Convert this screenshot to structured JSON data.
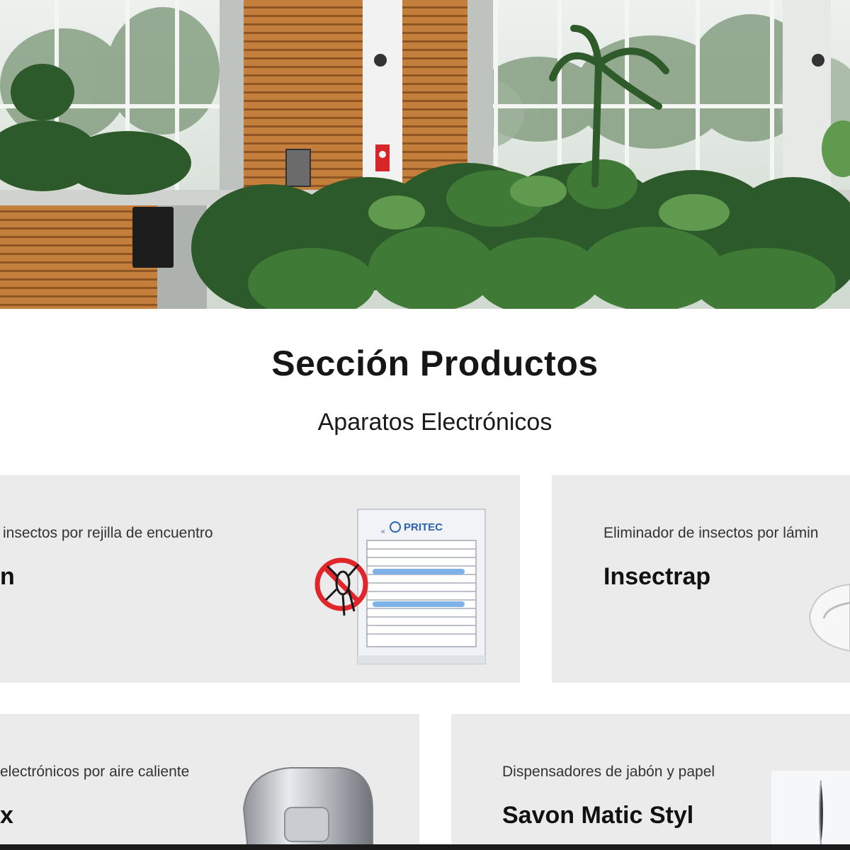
{
  "section": {
    "title": "Sección Productos",
    "subtitle": "Aparatos Electrónicos"
  },
  "cards": [
    {
      "category": "insectos por rejilla de encuentro",
      "name": "n",
      "image_icon": "insect-killer-grid-icon",
      "brand": "PRITEC"
    },
    {
      "category": "Eliminador de insectos por lámin",
      "name": "Insectrap",
      "image_icon": "insect-trap-lamp-icon"
    },
    {
      "category": "electrónicos por aire caliente",
      "name": "x",
      "image_icon": "hand-dryer-icon"
    },
    {
      "category": "Dispensadores de jabón y papel",
      "name": "Savon Matic Styl",
      "image_icon": "soap-dispenser-icon"
    }
  ],
  "colors": {
    "card_bg": "#ebebeb",
    "wood": "#c8843f",
    "foliage": "#2f5a2a",
    "accent_red": "#e0262b"
  }
}
